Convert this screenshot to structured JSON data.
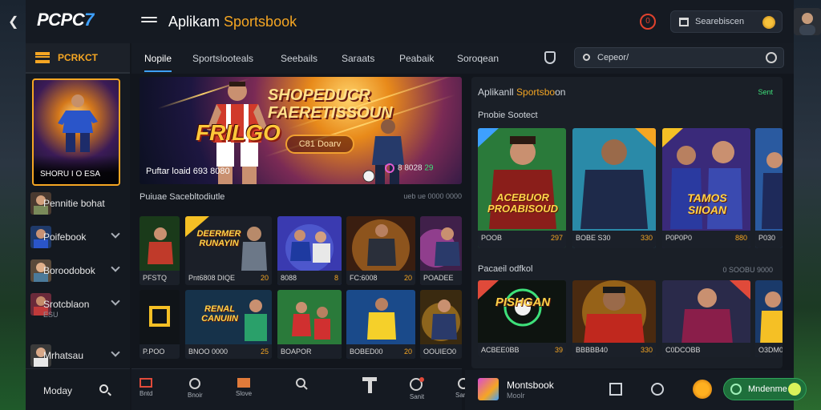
{
  "brand": {
    "logo_text": "PCPC",
    "logo_num": "7"
  },
  "header": {
    "title_prefix": "Aplikam ",
    "title_accent": "Sportsbook",
    "notif_badge": "0",
    "search_placeholder": "Searebiscen"
  },
  "sidebar": {
    "header_label": "PCRKCT",
    "promo_caption": "SHORU I O ESA",
    "items": [
      {
        "label": "Pennitie bohat",
        "sub": ""
      },
      {
        "label": "Poifebook",
        "sub": ""
      },
      {
        "label": "Boroodobok",
        "sub": ""
      },
      {
        "label": "Srotcblaon",
        "sub": "ESU"
      },
      {
        "label": "Mrhatsau",
        "sub": ""
      }
    ],
    "bottom_label": "Moday"
  },
  "tabs": [
    {
      "label": "Nopile"
    },
    {
      "label": "Sportslooteals"
    },
    {
      "label": "Seebails"
    },
    {
      "label": "Saraats"
    },
    {
      "label": "Peabaik"
    },
    {
      "label": "Soroqean"
    }
  ],
  "tab_search_placeholder": "Cepeor/",
  "hero": {
    "headline_1": "SHOPEDUCR",
    "headline_2": "FAERETISSOUN",
    "big_text": "FRILGO",
    "pill": "C81 Doarv",
    "caption": "Puftar loaid 693 8080",
    "count_text": "8 8028",
    "count_ok": "29"
  },
  "left_section": {
    "title": "Puiuae Sacebltodiutle",
    "more": "ueb ue 0000 0000",
    "games_row1": [
      {
        "title": "",
        "meta": "PFSTQ",
        "val": ""
      },
      {
        "title": "DEERMER RUNAYIN",
        "meta": "Pnt6808 DIQE",
        "val": "20"
      },
      {
        "title": "",
        "meta": "8088",
        "val": "8"
      },
      {
        "title": "",
        "meta": "FC:6008",
        "val": "20"
      },
      {
        "title": "",
        "meta": "POADEE",
        "val": ""
      }
    ],
    "games_row2": [
      {
        "title": "",
        "meta": "P.POO",
        "val": ""
      },
      {
        "title": "RENAL CANUIIN",
        "meta": "BNOO 0000",
        "val": "25"
      },
      {
        "title": "",
        "meta": "BOAPOR",
        "val": ""
      },
      {
        "title": "",
        "meta": "BOBED00",
        "val": "20"
      },
      {
        "title": "",
        "meta": "OOUIEO0",
        "val": ""
      }
    ]
  },
  "right_panel": {
    "title_prefix": "Aplikanll ",
    "title_accent": "Sportsbo",
    "title_suffix": "on",
    "title_right": "Sent",
    "section1": "Pnobie Sootect",
    "section1_more": "",
    "cards1": [
      {
        "title": "ACEBUOR PROABISOUD",
        "meta": "POOB",
        "val": "297"
      },
      {
        "title": "",
        "meta": "BOBE S30",
        "val": "330"
      },
      {
        "title": "TAMOS SIIOAN",
        "meta": "P0P0P0",
        "val": "880"
      },
      {
        "title": "",
        "meta": "P030",
        "val": ""
      }
    ],
    "section2": "Pacaeil odfkol",
    "section2_more": "0 SOOBU 9000",
    "cards2": [
      {
        "title": "PISHGAN",
        "meta": "ACBEE0BB",
        "val": "39"
      },
      {
        "title": "",
        "meta": "BBBBB40",
        "val": "330"
      },
      {
        "title": "",
        "meta": "C0DCOBB",
        "val": ""
      },
      {
        "title": "",
        "meta": "O3DM0",
        "val": ""
      }
    ]
  },
  "bottom_bar": {
    "items": [
      "Bntd",
      "Bnoir",
      "Slove",
      "",
      "",
      "Sanit",
      "Sanot"
    ]
  },
  "right_bottom": {
    "name": "Montsbook",
    "sub": "Moolr",
    "cta": "Mndenme"
  }
}
